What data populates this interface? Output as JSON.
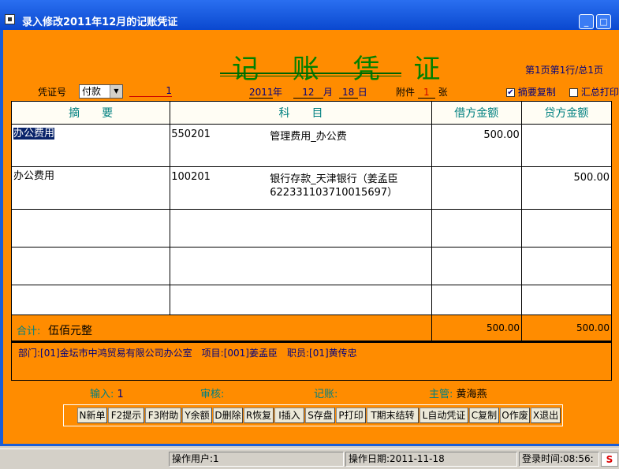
{
  "window": {
    "title": "录入修改2011年12月的记账凭证",
    "min_symbol": "_",
    "max_symbol": "□",
    "close_symbol": "×"
  },
  "voucher": {
    "title": "记 账 凭 证",
    "page_info": "第1页第1行/总1页",
    "type_label": "凭证号",
    "type_value": "付款",
    "number": "1",
    "year": "2011",
    "year_unit": "年",
    "month": "12",
    "month_unit": "月",
    "day": "18",
    "day_unit": "日",
    "attach_label": "附件",
    "attach_count": "1",
    "attach_unit": "张",
    "summary_copy_label": "摘要复制",
    "summary_copy_checked": true,
    "summary_print_label": "汇总打印",
    "summary_print_checked": false
  },
  "table": {
    "headers": [
      "摘　　要",
      "科　　目",
      "借方金额",
      "贷方金额"
    ],
    "rows": [
      {
        "summary": "办公费用",
        "code": "550201",
        "account": "管理费用_办公费",
        "account2": "",
        "debit": "500.00",
        "credit": ""
      },
      {
        "summary": "办公费用",
        "code": "100201",
        "account": "银行存款_天津银行（姜孟臣",
        "account2": "622331103710015697）",
        "debit": "",
        "credit": "500.00"
      },
      {
        "summary": "",
        "code": "",
        "account": "",
        "account2": "",
        "debit": "",
        "credit": ""
      },
      {
        "summary": "",
        "code": "",
        "account": "",
        "account2": "",
        "debit": "",
        "credit": ""
      },
      {
        "summary": "",
        "code": "",
        "account": "",
        "account2": "",
        "debit": "",
        "credit": ""
      }
    ],
    "total_label": "合计:",
    "total_words": "伍佰元整",
    "total_debit": "500.00",
    "total_credit": "500.00"
  },
  "info": {
    "text": "部门:[01]金坛市中鸿贸易有限公司办公室　项目:[001]姜孟臣　职员:[01]黄传忠"
  },
  "signatures": {
    "input_label": "输入:",
    "input_value": "1",
    "review_label": "审核:",
    "review_value": "",
    "bookkeep_label": "记账:",
    "bookkeep_value": "",
    "supervisor_label": "主管:",
    "supervisor_value": "黄海燕"
  },
  "buttons": [
    "N新单",
    "F2提示",
    "F3附助",
    "Y余额",
    "D删除",
    "R恢复",
    "I插入",
    "S存盘",
    "P打印",
    "T期末结转",
    "L自动凭证",
    "C复制",
    "O作废",
    "X退出"
  ],
  "statusbar": {
    "user": "操作用户:1",
    "date": "操作日期:2011-11-18",
    "login": "登录时间:08:56:",
    "tray": "S"
  }
}
